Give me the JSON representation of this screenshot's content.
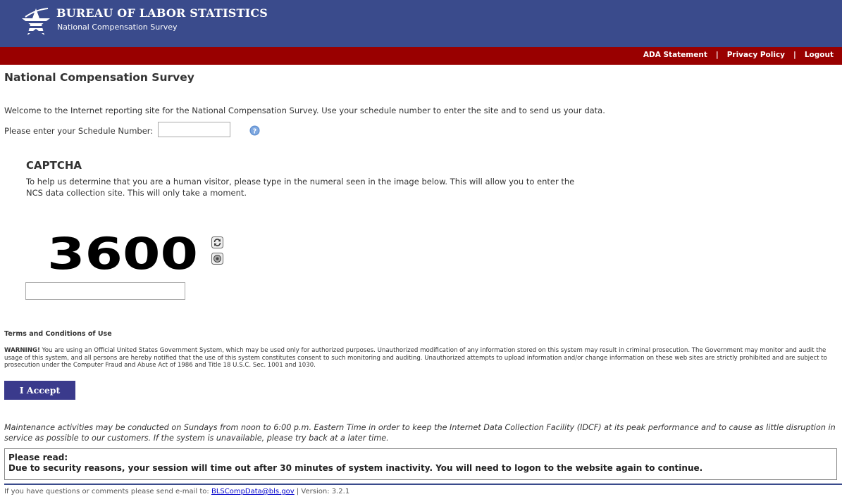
{
  "header": {
    "agency": "BUREAU OF LABOR STATISTICS",
    "subtitle": "National Compensation Survey"
  },
  "top_links": {
    "ada": "ADA Statement",
    "privacy": "Privacy Policy",
    "logout": "Logout",
    "separator": "|"
  },
  "main": {
    "title": "National Compensation Survey",
    "welcome": "Welcome to the Internet reporting site for the National Compensation Survey. Use your schedule number to enter the site and to send us your data.",
    "schedule_label": "Please enter your Schedule Number:",
    "schedule_value": ""
  },
  "captcha": {
    "title": "CAPTCHA",
    "text": "To help us determine that you are a human visitor, please type in the numeral seen in the image below. This will allow you to enter the NCS data collection site. This will only take a moment.",
    "code": "3600",
    "input_value": ""
  },
  "terms": {
    "title": "Terms and Conditions of Use",
    "warning_label": "WARNING!",
    "warning_text": " You are using an Official United States Government System, which may be used only for authorized purposes. Unauthorized modification of any information stored on this system may result in criminal prosecution. The Government may monitor and audit the usage of this system, and all persons are hereby notified that the use of this system constitutes consent to such monitoring and auditing. Unauthorized attempts to upload information and/or change information on these web sites are strictly prohibited and are subject to prosecution under the Computer Fraud and Abuse Act of 1986 and Title 18 U.S.C. Sec. 1001 and 1030.",
    "accept_label": "I Accept"
  },
  "maintenance": "Maintenance activities may be conducted on Sundays from noon to 6:00 p.m. Eastern Time in order to keep the Internet Data Collection Facility (IDCF) at its peak performance and to cause as little disruption in service as possible to our customers. If the system is unavailable, please try back at a later time.",
  "notice": {
    "heading": "Please read:",
    "text": "Due to security reasons, your session will time out after 30 minutes of system inactivity. You will need to logon to the website again to continue."
  },
  "footer": {
    "prefix": "If you have questions or comments please send e-mail to: ",
    "email": "BLSCompData@bls.gov",
    "version": " | Version: 3.2.1"
  },
  "colors": {
    "header_blue": "#3a4b8c",
    "bar_red": "#990000",
    "button_blue": "#3a3a8c"
  },
  "icons": [
    "bls-star-logo-icon",
    "help-icon",
    "refresh-icon",
    "audio-icon"
  ]
}
